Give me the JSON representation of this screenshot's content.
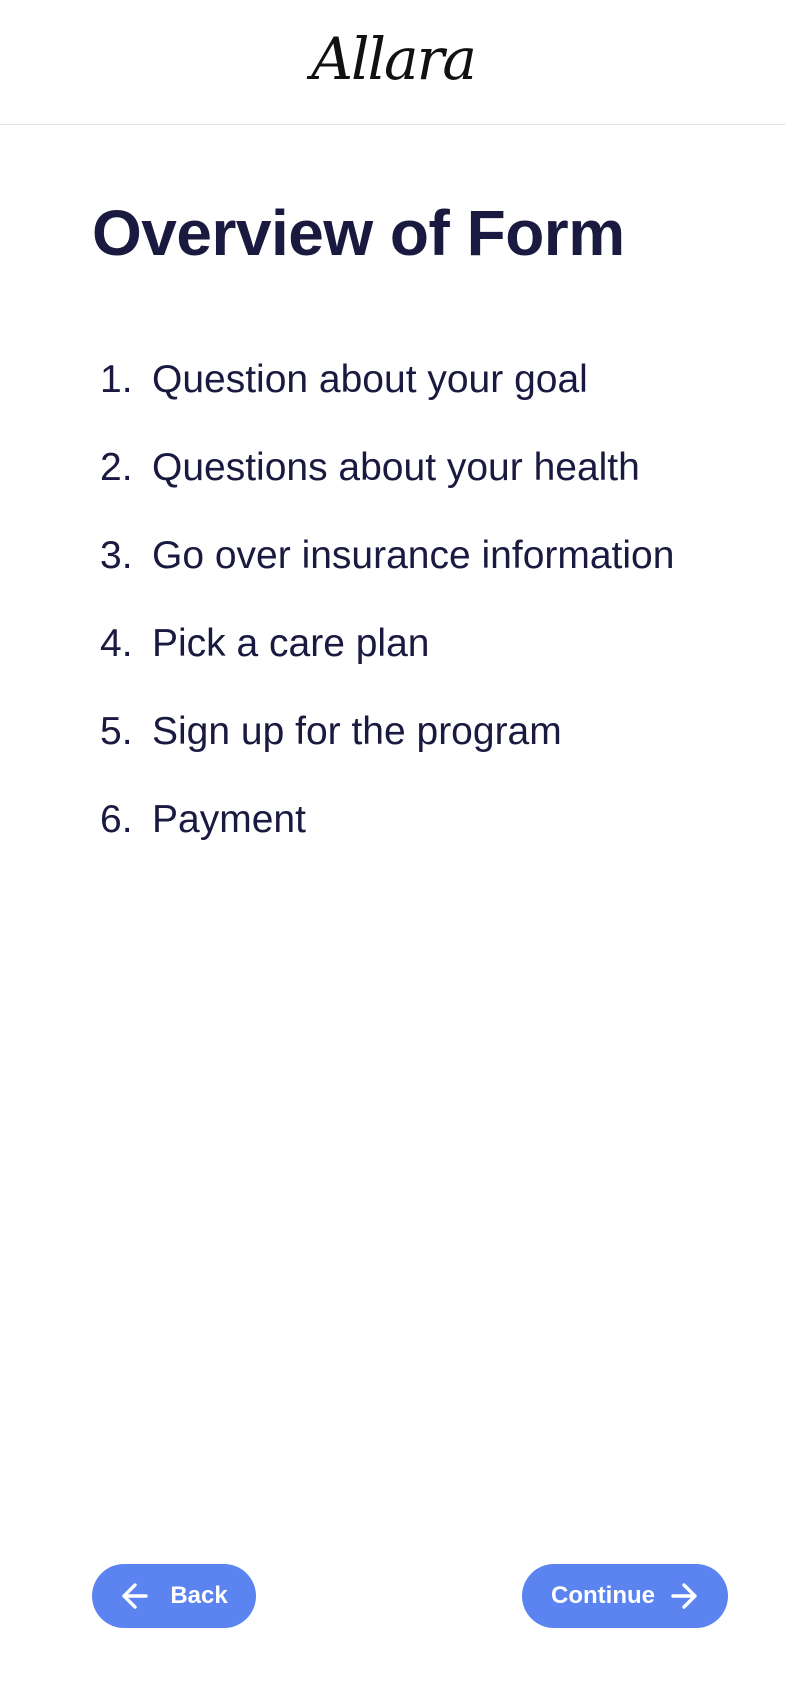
{
  "header": {
    "logo_text": "Allara"
  },
  "main": {
    "title": "Overview of Form",
    "steps": [
      {
        "number": "1.",
        "label": "Question about your goal"
      },
      {
        "number": "2.",
        "label": "Questions about your health"
      },
      {
        "number": "3.",
        "label": "Go over insurance information"
      },
      {
        "number": "4.",
        "label": "Pick a care plan"
      },
      {
        "number": "5.",
        "label": "Sign up for the program"
      },
      {
        "number": "6.",
        "label": "Payment"
      }
    ]
  },
  "footer": {
    "back_label": "Back",
    "back_icon": "arrow-left-icon",
    "continue_label": "Continue",
    "continue_icon": "arrow-right-icon"
  },
  "colors": {
    "accent": "#5b84f0",
    "text": "#1a1a40",
    "divider": "#e3e3e8"
  }
}
